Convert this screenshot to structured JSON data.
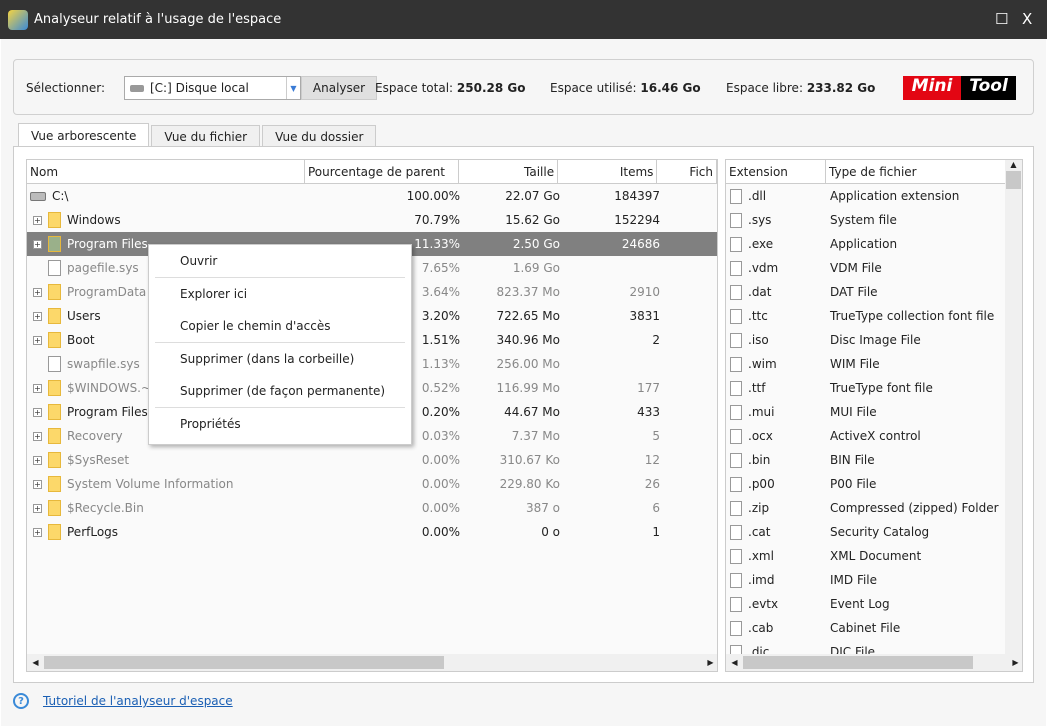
{
  "window": {
    "title": "Analyseur relatif à l'usage de l'espace",
    "maximize": "☐",
    "close": "X"
  },
  "toolbar": {
    "select_label": "Sélectionner:",
    "drive": "[C:] Disque local",
    "analyze": "Analyser",
    "total_label": "Espace total:",
    "total": "250.28 Go",
    "used_label": "Espace utilisé:",
    "used": "16.46 Go",
    "free_label": "Espace libre:",
    "free": "233.82 Go",
    "logo_a": "Mini",
    "logo_b": "Tool"
  },
  "tabs": [
    {
      "label": "Vue arborescente",
      "active": true
    },
    {
      "label": "Vue du fichier"
    },
    {
      "label": "Vue du dossier"
    }
  ],
  "tree": {
    "columns": [
      "Nom",
      "Pourcentage de parent",
      "Taille",
      "Items",
      "Fich"
    ],
    "rows": [
      {
        "name": "C:\\",
        "pct": "100.00%",
        "size": "22.07 Go",
        "items": "184397",
        "type": "drive"
      },
      {
        "name": "Windows",
        "pct": "70.79%",
        "size": "15.62 Go",
        "items": "152294",
        "type": "folder"
      },
      {
        "name": "Program Files",
        "pct": "11.33%",
        "size": "2.50 Go",
        "items": "24686",
        "type": "folder",
        "selected": true
      },
      {
        "name": "pagefile.sys",
        "pct": "7.65%",
        "size": "1.69 Go",
        "items": "",
        "type": "file",
        "gray": true
      },
      {
        "name": "ProgramData",
        "pct": "3.64%",
        "size": "823.37 Mo",
        "items": "2910",
        "type": "folder",
        "gray": true
      },
      {
        "name": "Users",
        "pct": "3.20%",
        "size": "722.65 Mo",
        "items": "3831",
        "type": "folder"
      },
      {
        "name": "Boot",
        "pct": "1.51%",
        "size": "340.96 Mo",
        "items": "2",
        "type": "folder"
      },
      {
        "name": "swapfile.sys",
        "pct": "1.13%",
        "size": "256.00 Mo",
        "items": "",
        "type": "file",
        "gray": true
      },
      {
        "name": "$WINDOWS.~",
        "pct": "0.52%",
        "size": "116.99 Mo",
        "items": "177",
        "type": "folder",
        "gray": true
      },
      {
        "name": "Program Files",
        "pct": "0.20%",
        "size": "44.67 Mo",
        "items": "433",
        "type": "folder"
      },
      {
        "name": "Recovery",
        "pct": "0.03%",
        "size": "7.37 Mo",
        "items": "5",
        "type": "folder",
        "gray": true
      },
      {
        "name": "$SysReset",
        "pct": "0.00%",
        "size": "310.67 Ko",
        "items": "12",
        "type": "folder",
        "gray": true
      },
      {
        "name": "System Volume Information",
        "pct": "0.00%",
        "size": "229.80 Ko",
        "items": "26",
        "type": "folder",
        "gray": true
      },
      {
        "name": "$Recycle.Bin",
        "pct": "0.00%",
        "size": "387 o",
        "items": "6",
        "type": "folder",
        "gray": true
      },
      {
        "name": "PerfLogs",
        "pct": "0.00%",
        "size": "0 o",
        "items": "1",
        "type": "folder"
      }
    ]
  },
  "context_menu": [
    [
      "Ouvrir"
    ],
    [
      "Explorer ici",
      "Copier le chemin d'accès"
    ],
    [
      "Supprimer (dans la corbeille)",
      "Supprimer (de façon permanente)"
    ],
    [
      "Propriétés"
    ]
  ],
  "extensions": {
    "columns": [
      "Extension",
      "Type de fichier"
    ],
    "rows": [
      [
        ".dll",
        "Application extension"
      ],
      [
        ".sys",
        "System file"
      ],
      [
        ".exe",
        "Application"
      ],
      [
        ".vdm",
        "VDM File"
      ],
      [
        ".dat",
        "DAT File"
      ],
      [
        ".ttc",
        "TrueType collection font file"
      ],
      [
        ".iso",
        "Disc Image File"
      ],
      [
        ".wim",
        "WIM File"
      ],
      [
        ".ttf",
        "TrueType font file"
      ],
      [
        ".mui",
        "MUI File"
      ],
      [
        ".ocx",
        "ActiveX control"
      ],
      [
        ".bin",
        "BIN File"
      ],
      [
        ".p00",
        "P00 File"
      ],
      [
        ".zip",
        "Compressed (zipped) Folder"
      ],
      [
        ".cat",
        "Security Catalog"
      ],
      [
        ".xml",
        "XML Document"
      ],
      [
        ".imd",
        "IMD File"
      ],
      [
        ".evtx",
        "Event Log"
      ],
      [
        ".cab",
        "Cabinet File"
      ],
      [
        ".dic",
        "DIC File"
      ]
    ]
  },
  "footer": {
    "link": "Tutoriel de l'analyseur d'espace"
  }
}
